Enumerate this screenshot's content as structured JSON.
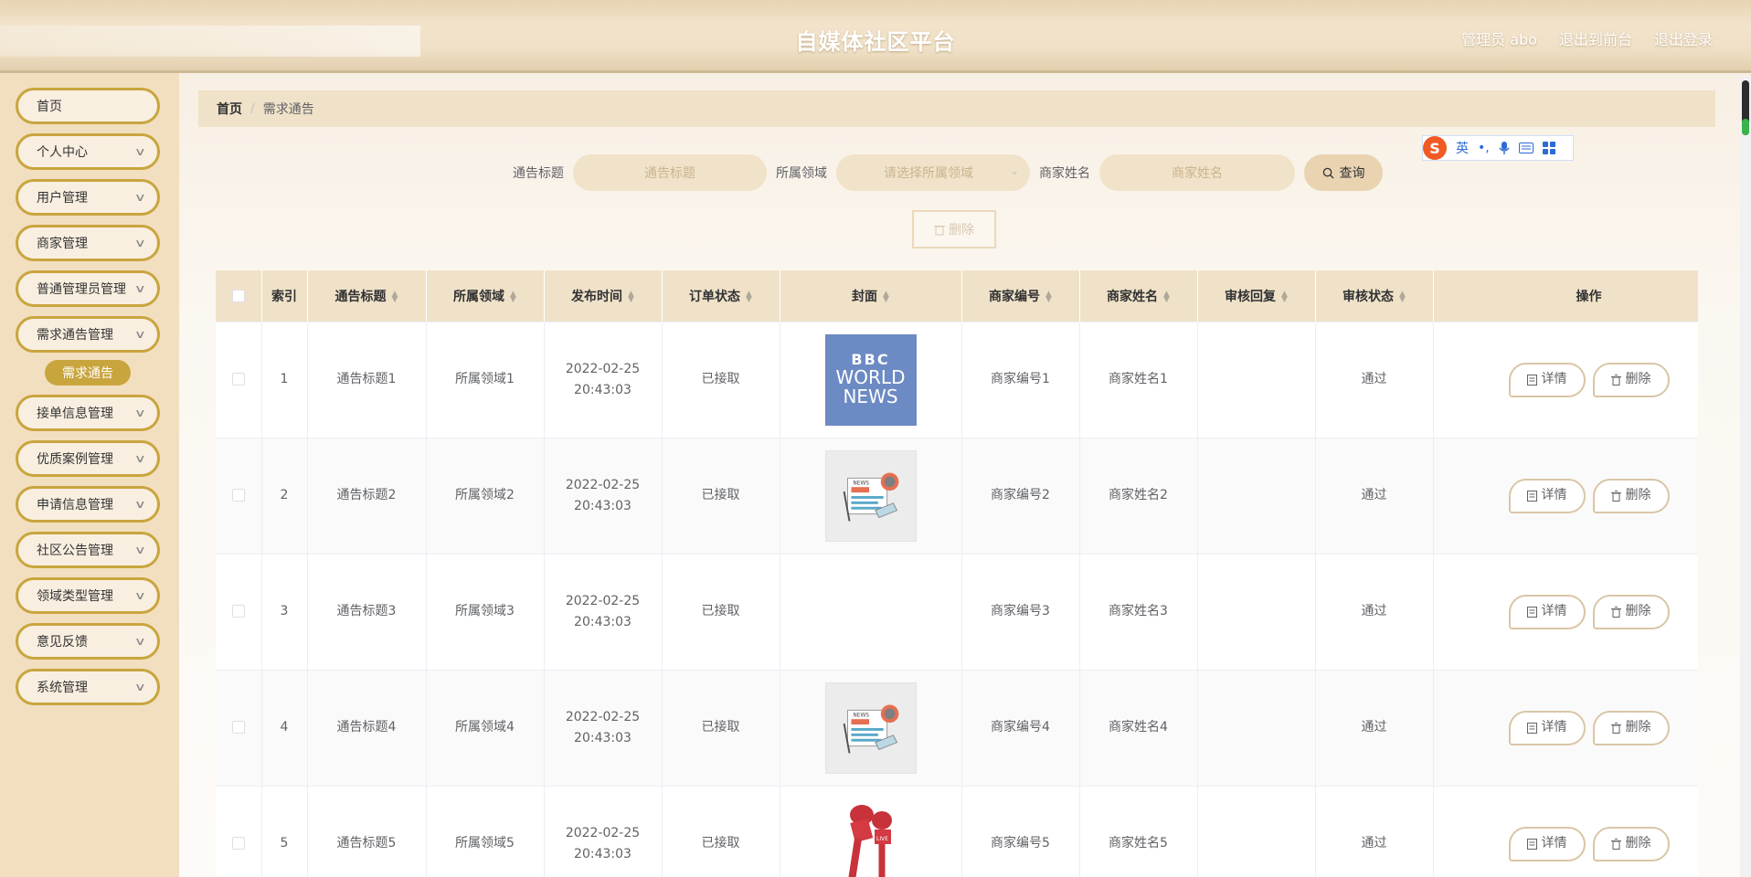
{
  "header": {
    "title": "自媒体社区平台",
    "admin": "管理员 abo",
    "to_frontend": "退出到前台",
    "logout": "退出登录"
  },
  "sidebar": {
    "items": [
      {
        "label": "首页",
        "has_arrow": false
      },
      {
        "label": "个人中心",
        "has_arrow": true
      },
      {
        "label": "用户管理",
        "has_arrow": true
      },
      {
        "label": "商家管理",
        "has_arrow": true
      },
      {
        "label": "普通管理员管理",
        "has_arrow": true
      },
      {
        "label": "需求通告管理",
        "has_arrow": true
      },
      {
        "label": "接单信息管理",
        "has_arrow": true
      },
      {
        "label": "优质案例管理",
        "has_arrow": true
      },
      {
        "label": "申请信息管理",
        "has_arrow": true
      },
      {
        "label": "社区公告管理",
        "has_arrow": true
      },
      {
        "label": "领域类型管理",
        "has_arrow": true
      },
      {
        "label": "意见反馈",
        "has_arrow": true
      },
      {
        "label": "系统管理",
        "has_arrow": true
      }
    ],
    "active_sub": "需求通告"
  },
  "breadcrumb": {
    "home": "首页",
    "current": "需求通告"
  },
  "search": {
    "title_label": "通告标题",
    "title_placeholder": "通告标题",
    "field_label": "所属领域",
    "field_placeholder": "请选择所属领域",
    "merchant_label": "商家姓名",
    "merchant_placeholder": "商家姓名",
    "query_label": "查询"
  },
  "ime": {
    "logo": "S",
    "lang": "英"
  },
  "delete_label": "删除",
  "table": {
    "headers": [
      "索引",
      "通告标题",
      "所属领域",
      "发布时间",
      "订单状态",
      "封面",
      "商家编号",
      "商家姓名",
      "审核回复",
      "审核状态",
      "操作"
    ],
    "rows": [
      {
        "index": "1",
        "title": "通告标题1",
        "field": "所属领域1",
        "time": "2022-02-25 20:43:03",
        "order_status": "已接取",
        "cover": "bbc",
        "merchant_no": "商家编号1",
        "merchant_name": "商家姓名1",
        "reply": "",
        "audit": "通过"
      },
      {
        "index": "2",
        "title": "通告标题2",
        "field": "所属领域2",
        "time": "2022-02-25 20:43:03",
        "order_status": "已接取",
        "cover": "newspaper",
        "merchant_no": "商家编号2",
        "merchant_name": "商家姓名2",
        "reply": "",
        "audit": "通过"
      },
      {
        "index": "3",
        "title": "通告标题3",
        "field": "所属领域3",
        "time": "2022-02-25 20:43:03",
        "order_status": "已接取",
        "cover": "none",
        "merchant_no": "商家编号3",
        "merchant_name": "商家姓名3",
        "reply": "",
        "audit": "通过"
      },
      {
        "index": "4",
        "title": "通告标题4",
        "field": "所属领域4",
        "time": "2022-02-25 20:43:03",
        "order_status": "已接取",
        "cover": "newspaper",
        "merchant_no": "商家编号4",
        "merchant_name": "商家姓名4",
        "reply": "",
        "audit": "通过"
      },
      {
        "index": "5",
        "title": "通告标题5",
        "field": "所属领域5",
        "time": "2022-02-25 20:43:03",
        "order_status": "已接取",
        "cover": "microphone",
        "merchant_no": "商家编号5",
        "merchant_name": "商家姓名5",
        "reply": "",
        "audit": "通过"
      }
    ],
    "bbc_text": {
      "top": "BBC",
      "mid": "WORLD",
      "bot": "NEWS"
    },
    "newspaper_text": "NEWS",
    "mic_text": "LIVE",
    "detail_label": "详情",
    "delete_label": "删除"
  },
  "colors": {
    "accent": "#c9a53e",
    "header_bg": "#f0e2c8"
  }
}
